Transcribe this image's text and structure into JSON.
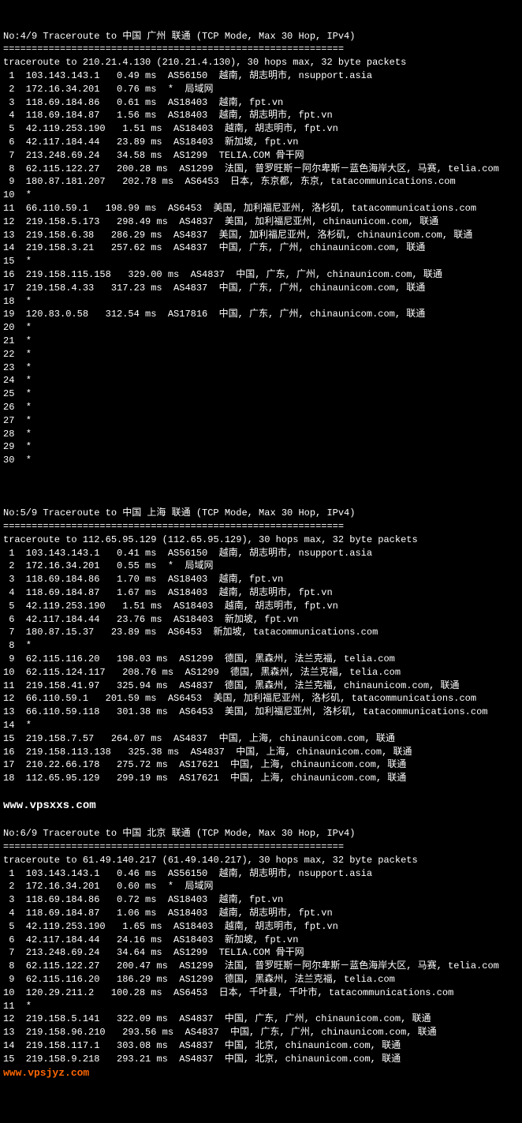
{
  "trace4": {
    "title": "No:4/9 Traceroute to 中国 广州 联通 (TCP Mode, Max 30 Hop, IPv4)",
    "divider": "============================================================",
    "header": "traceroute to 210.21.4.130 (210.21.4.130), 30 hops max, 32 byte packets",
    "hops": [
      " 1  103.143.143.1   0.49 ms  AS56150  越南, 胡志明市, nsupport.asia",
      " 2  172.16.34.201   0.76 ms  *  局域网",
      " 3  118.69.184.86   0.61 ms  AS18403  越南, fpt.vn",
      " 4  118.69.184.87   1.56 ms  AS18403  越南, 胡志明市, fpt.vn",
      " 5  42.119.253.190   1.51 ms  AS18403  越南, 胡志明市, fpt.vn",
      " 6  42.117.184.44   23.89 ms  AS18403  新加坡, fpt.vn",
      " 7  213.248.69.24   34.58 ms  AS1299  TELIA.COM 骨干网",
      " 8  62.115.122.27   200.28 ms  AS1299  法国, 普罗旺斯－阿尔卑斯－蓝色海岸大区, 马赛, telia.com",
      " 9  180.87.181.207   202.78 ms  AS6453  日本, 东京都, 东京, tatacommunications.com",
      "10  *",
      "11  66.110.59.1   198.99 ms  AS6453  美国, 加利福尼亚州, 洛杉矶, tatacommunications.com",
      "12  219.158.5.173   298.49 ms  AS4837  美国, 加利福尼亚州, chinaunicom.com, 联通",
      "13  219.158.6.38   286.29 ms  AS4837  美国, 加利福尼亚州, 洛杉矶, chinaunicom.com, 联通",
      "14  219.158.3.21   257.62 ms  AS4837  中国, 广东, 广州, chinaunicom.com, 联通",
      "15  *",
      "16  219.158.115.158   329.00 ms  AS4837  中国, 广东, 广州, chinaunicom.com, 联通",
      "17  219.158.4.33   317.23 ms  AS4837  中国, 广东, 广州, chinaunicom.com, 联通",
      "18  *",
      "19  120.83.0.58   312.54 ms  AS17816  中国, 广东, 广州, chinaunicom.com, 联通",
      "20  *",
      "21  *",
      "22  *",
      "23  *",
      "24  *",
      "25  *",
      "26  *",
      "27  *",
      "28  *",
      "29  *",
      "30  *"
    ]
  },
  "trace5": {
    "title": "No:5/9 Traceroute to 中国 上海 联通 (TCP Mode, Max 30 Hop, IPv4)",
    "divider": "============================================================",
    "header": "traceroute to 112.65.95.129 (112.65.95.129), 30 hops max, 32 byte packets",
    "hops": [
      " 1  103.143.143.1   0.41 ms  AS56150  越南, 胡志明市, nsupport.asia",
      " 2  172.16.34.201   0.55 ms  *  局域网",
      " 3  118.69.184.86   1.70 ms  AS18403  越南, fpt.vn",
      " 4  118.69.184.87   1.67 ms  AS18403  越南, 胡志明市, fpt.vn",
      " 5  42.119.253.190   1.51 ms  AS18403  越南, 胡志明市, fpt.vn",
      " 6  42.117.184.44   23.76 ms  AS18403  新加坡, fpt.vn",
      " 7  180.87.15.37   23.89 ms  AS6453  新加坡, tatacommunications.com",
      " 8  *",
      " 9  62.115.116.20   198.03 ms  AS1299  德国, 黑森州, 法兰克福, telia.com",
      "10  62.115.124.117   208.76 ms  AS1299  德国, 黑森州, 法兰克福, telia.com",
      "11  219.158.41.97   325.94 ms  AS4837  德国, 黑森州, 法兰克福, chinaunicom.com, 联通",
      "12  66.110.59.1   201.59 ms  AS6453  美国, 加利福尼亚州, 洛杉矶, tatacommunications.com",
      "13  66.110.59.118   301.38 ms  AS6453  美国, 加利福尼亚州, 洛杉矶, tatacommunications.com",
      "14  *",
      "15  219.158.7.57   264.07 ms  AS4837  中国, 上海, chinaunicom.com, 联通",
      "16  219.158.113.138   325.38 ms  AS4837  中国, 上海, chinaunicom.com, 联通",
      "17  210.22.66.178   275.72 ms  AS17621  中国, 上海, chinaunicom.com, 联通",
      "18  112.65.95.129   299.19 ms  AS17621  中国, 上海, chinaunicom.com, 联通"
    ]
  },
  "watermark1": "www.vpsxxs.com",
  "trace6": {
    "title": "No:6/9 Traceroute to 中国 北京 联通 (TCP Mode, Max 30 Hop, IPv4)",
    "divider": "============================================================",
    "header": "traceroute to 61.49.140.217 (61.49.140.217), 30 hops max, 32 byte packets",
    "hops": [
      " 1  103.143.143.1   0.46 ms  AS56150  越南, 胡志明市, nsupport.asia",
      " 2  172.16.34.201   0.60 ms  *  局域网",
      " 3  118.69.184.86   0.72 ms  AS18403  越南, fpt.vn",
      " 4  118.69.184.87   1.06 ms  AS18403  越南, 胡志明市, fpt.vn",
      " 5  42.119.253.190   1.65 ms  AS18403  越南, 胡志明市, fpt.vn",
      " 6  42.117.184.44   24.16 ms  AS18403  新加坡, fpt.vn",
      " 7  213.248.69.24   34.64 ms  AS1299  TELIA.COM 骨干网",
      " 8  62.115.122.27   200.47 ms  AS1299  法国, 普罗旺斯－阿尔卑斯－蓝色海岸大区, 马赛, telia.com",
      " 9  62.115.116.20   186.29 ms  AS1299  德国, 黑森州, 法兰克福, telia.com",
      "10  120.29.211.2   100.28 ms  AS6453  日本, 千叶县, 千叶市, tatacommunications.com",
      "11  *",
      "12  219.158.5.141   322.09 ms  AS4837  中国, 广东, 广州, chinaunicom.com, 联通",
      "13  219.158.96.210   293.56 ms  AS4837  中国, 广东, 广州, chinaunicom.com, 联通",
      "14  219.158.117.1   303.08 ms  AS4837  中国, 北京, chinaunicom.com, 联通",
      "15  219.158.9.218   293.21 ms  AS4837  中国, 北京, chinaunicom.com, 联通"
    ]
  },
  "watermark2": "www.vpsjyz.com"
}
